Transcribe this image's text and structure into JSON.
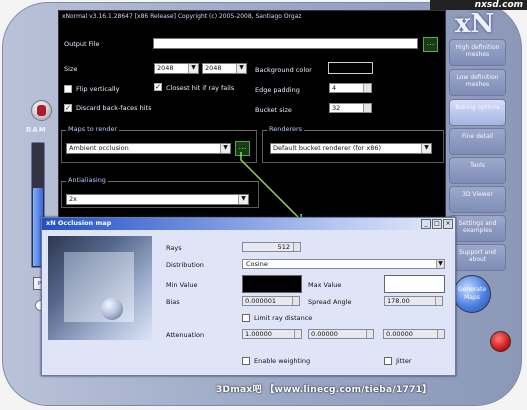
{
  "window": {
    "title": "xNormal v3.16.1.28647 [x86 Release] Copyright (c) 2005-2008, Santiago Orgaz",
    "watermark": "nxsd.com",
    "logo": "xN",
    "ram_label": "RAM",
    "ram_fill_fraction": 0.63
  },
  "main": {
    "output_file_label": "Output File",
    "output_file_value": "",
    "size_label": "Size",
    "size_width": "2048",
    "size_height": "2048",
    "flip_vertically_label": "Flip vertically",
    "flip_vertically_checked": false,
    "closest_hit_label": "Closest hit if ray fails",
    "closest_hit_checked": true,
    "discard_back_faces_label": "Discard back-faces hits",
    "discard_back_faces_checked": true,
    "background_color_label": "Background color",
    "edge_padding_label": "Edge padding",
    "edge_padding_value": "4",
    "bucket_size_label": "Bucket size",
    "bucket_size_value": "32",
    "maps_to_render_label": "Maps to render",
    "maps_to_render_value": "Ambient occlusion",
    "antialiasing_label": "Antialiasing",
    "antialiasing_value": "2x",
    "renderer_label": "Renderers",
    "renderer_value": "Default bucket renderer (for x86)"
  },
  "nav": {
    "items": [
      {
        "label": "High definition meshes"
      },
      {
        "label": "Low definition meshes"
      },
      {
        "label": "Baking options"
      },
      {
        "label": "Fine detail"
      },
      {
        "label": "Tools"
      },
      {
        "label": "3D Viewer"
      },
      {
        "label": "Settings and examples"
      },
      {
        "label": "Support and about"
      }
    ],
    "generate_label": "Generate Maps"
  },
  "dialog": {
    "title": "Occlusion map",
    "rays_label": "Rays",
    "rays_value": "512",
    "distribution_label": "Distribution",
    "distribution_value": "Cosine",
    "min_value_label": "Min Value",
    "max_value_label": "Max Value",
    "bias_label": "Bias",
    "bias_value": "0.000001",
    "spread_angle_label": "Spread Angle",
    "spread_angle_value": "178.00",
    "limit_ray_distance_label": "Limit ray distance",
    "attenuation_label": "Attenuation",
    "attenuation_values": [
      "1.00000",
      "0.00000",
      "0.00000"
    ],
    "enable_weighting_label": "Enable weighting",
    "jitter_label": "Jitter"
  },
  "caption": "3Dmax吧 【www.linecg.com/tieba/1771】",
  "colors": {
    "accent": "#4c7fe0",
    "green_button": "#153e14",
    "power": "#d01818"
  }
}
